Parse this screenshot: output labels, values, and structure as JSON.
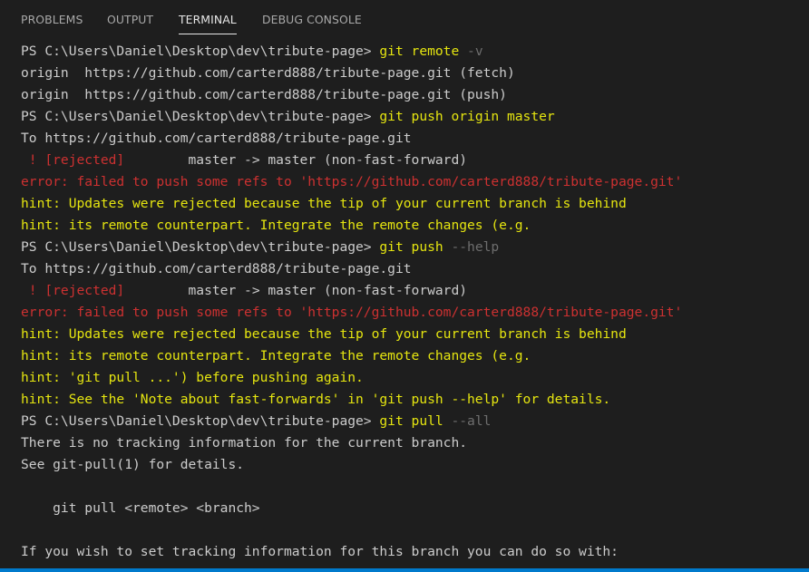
{
  "tabs": [
    {
      "label": "PROBLEMS",
      "active": false
    },
    {
      "label": "OUTPUT",
      "active": false
    },
    {
      "label": "TERMINAL",
      "active": true
    },
    {
      "label": "DEBUG CONSOLE",
      "active": false
    }
  ],
  "colors": {
    "background": "#1e1e1e",
    "default_text": "#cccccc",
    "command": "#e5e510",
    "flag": "#6e6e6e",
    "error": "#cd3131",
    "hint": "#e5e510",
    "status_bar": "#007acc"
  },
  "terminal": {
    "lines": [
      {
        "kind": "prompt",
        "prompt": "PS C:\\Users\\Daniel\\Desktop\\dev\\tribute-page> ",
        "cmd": "git",
        "args": " remote ",
        "flag": "-v"
      },
      {
        "kind": "out",
        "text": "origin  https://github.com/carterd888/tribute-page.git (fetch)"
      },
      {
        "kind": "out",
        "text": "origin  https://github.com/carterd888/tribute-page.git (push)"
      },
      {
        "kind": "prompt",
        "prompt": "PS C:\\Users\\Daniel\\Desktop\\dev\\tribute-page> ",
        "cmd": "git",
        "args": " push origin master",
        "flag": ""
      },
      {
        "kind": "out",
        "text": "To https://github.com/carterd888/tribute-page.git"
      },
      {
        "kind": "rejected",
        "red": " ! [rejected]",
        "rest": "        master -> master (non-fast-forward)"
      },
      {
        "kind": "error",
        "text": "error: failed to push some refs to 'https://github.com/carterd888/tribute-page.git'"
      },
      {
        "kind": "hint",
        "text": "hint: Updates were rejected because the tip of your current branch is behind"
      },
      {
        "kind": "hint",
        "text": "hint: its remote counterpart. Integrate the remote changes (e.g."
      },
      {
        "kind": "prompt",
        "prompt": "PS C:\\Users\\Daniel\\Desktop\\dev\\tribute-page> ",
        "cmd": "git",
        "args": " push ",
        "flag": "--help"
      },
      {
        "kind": "out",
        "text": "To https://github.com/carterd888/tribute-page.git"
      },
      {
        "kind": "rejected",
        "red": " ! [rejected]",
        "rest": "        master -> master (non-fast-forward)"
      },
      {
        "kind": "error",
        "text": "error: failed to push some refs to 'https://github.com/carterd888/tribute-page.git'"
      },
      {
        "kind": "hint",
        "text": "hint: Updates were rejected because the tip of your current branch is behind"
      },
      {
        "kind": "hint",
        "text": "hint: its remote counterpart. Integrate the remote changes (e.g."
      },
      {
        "kind": "hint",
        "text": "hint: 'git pull ...') before pushing again."
      },
      {
        "kind": "hint",
        "text": "hint: See the 'Note about fast-forwards' in 'git push --help' for details."
      },
      {
        "kind": "prompt",
        "prompt": "PS C:\\Users\\Daniel\\Desktop\\dev\\tribute-page> ",
        "cmd": "git",
        "args": " pull ",
        "flag": "--all"
      },
      {
        "kind": "out",
        "text": "There is no tracking information for the current branch."
      },
      {
        "kind": "out",
        "text": "See git-pull(1) for details."
      },
      {
        "kind": "out",
        "text": ""
      },
      {
        "kind": "out",
        "text": "    git pull <remote> <branch>"
      },
      {
        "kind": "out",
        "text": ""
      },
      {
        "kind": "out",
        "text": "If you wish to set tracking information for this branch you can do so with:"
      }
    ]
  }
}
